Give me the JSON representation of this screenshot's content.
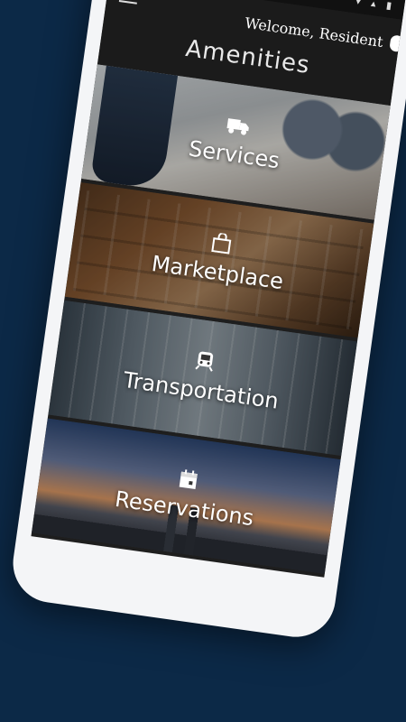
{
  "header": {
    "welcome": "Welcome, Resident",
    "title": "Amenities"
  },
  "icons": {
    "menu": "menu-icon",
    "services": "truck-icon",
    "marketplace": "shopping-bag-icon",
    "transportation": "train-icon",
    "reservations": "calendar-icon"
  },
  "tiles": [
    {
      "label": "Services"
    },
    {
      "label": "Marketplace"
    },
    {
      "label": "Transportation"
    },
    {
      "label": "Reservations"
    }
  ],
  "colors": {
    "background": "#0c2947",
    "appbar": "#1b1b1b"
  }
}
